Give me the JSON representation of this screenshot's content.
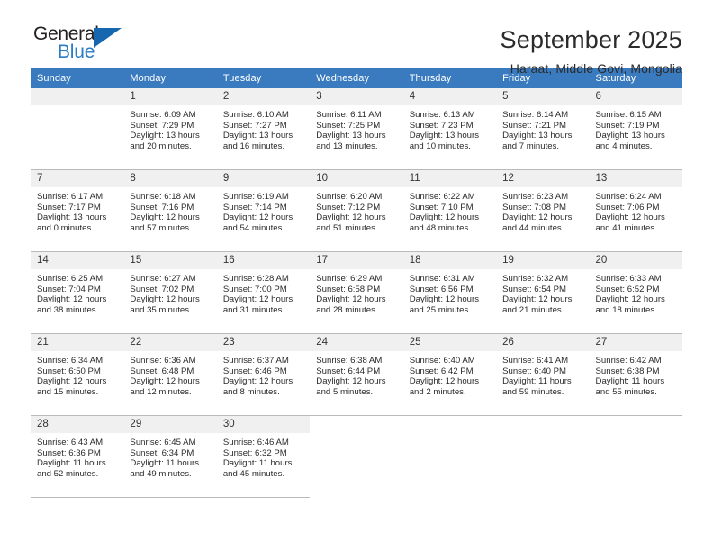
{
  "brand": {
    "name_top": "General",
    "name_bottom": "Blue",
    "triangle_color": "#1666b0",
    "blue": "#2b7cc4"
  },
  "header": {
    "month_title": "September 2025",
    "location": "Haraat, Middle Govi, Mongolia"
  },
  "calendar": {
    "header_bg": "#3a7bbf",
    "daynum_bg": "#f0f0f0",
    "weekdays": [
      "Sunday",
      "Monday",
      "Tuesday",
      "Wednesday",
      "Thursday",
      "Friday",
      "Saturday"
    ],
    "weeks": [
      [
        {
          "day": "",
          "sunrise": "",
          "sunset": "",
          "daylight1": "",
          "daylight2": "",
          "blank": true
        },
        {
          "day": "1",
          "sunrise": "Sunrise: 6:09 AM",
          "sunset": "Sunset: 7:29 PM",
          "daylight1": "Daylight: 13 hours",
          "daylight2": "and 20 minutes."
        },
        {
          "day": "2",
          "sunrise": "Sunrise: 6:10 AM",
          "sunset": "Sunset: 7:27 PM",
          "daylight1": "Daylight: 13 hours",
          "daylight2": "and 16 minutes."
        },
        {
          "day": "3",
          "sunrise": "Sunrise: 6:11 AM",
          "sunset": "Sunset: 7:25 PM",
          "daylight1": "Daylight: 13 hours",
          "daylight2": "and 13 minutes."
        },
        {
          "day": "4",
          "sunrise": "Sunrise: 6:13 AM",
          "sunset": "Sunset: 7:23 PM",
          "daylight1": "Daylight: 13 hours",
          "daylight2": "and 10 minutes."
        },
        {
          "day": "5",
          "sunrise": "Sunrise: 6:14 AM",
          "sunset": "Sunset: 7:21 PM",
          "daylight1": "Daylight: 13 hours",
          "daylight2": "and 7 minutes."
        },
        {
          "day": "6",
          "sunrise": "Sunrise: 6:15 AM",
          "sunset": "Sunset: 7:19 PM",
          "daylight1": "Daylight: 13 hours",
          "daylight2": "and 4 minutes."
        }
      ],
      [
        {
          "day": "7",
          "sunrise": "Sunrise: 6:17 AM",
          "sunset": "Sunset: 7:17 PM",
          "daylight1": "Daylight: 13 hours",
          "daylight2": "and 0 minutes."
        },
        {
          "day": "8",
          "sunrise": "Sunrise: 6:18 AM",
          "sunset": "Sunset: 7:16 PM",
          "daylight1": "Daylight: 12 hours",
          "daylight2": "and 57 minutes."
        },
        {
          "day": "9",
          "sunrise": "Sunrise: 6:19 AM",
          "sunset": "Sunset: 7:14 PM",
          "daylight1": "Daylight: 12 hours",
          "daylight2": "and 54 minutes."
        },
        {
          "day": "10",
          "sunrise": "Sunrise: 6:20 AM",
          "sunset": "Sunset: 7:12 PM",
          "daylight1": "Daylight: 12 hours",
          "daylight2": "and 51 minutes."
        },
        {
          "day": "11",
          "sunrise": "Sunrise: 6:22 AM",
          "sunset": "Sunset: 7:10 PM",
          "daylight1": "Daylight: 12 hours",
          "daylight2": "and 48 minutes."
        },
        {
          "day": "12",
          "sunrise": "Sunrise: 6:23 AM",
          "sunset": "Sunset: 7:08 PM",
          "daylight1": "Daylight: 12 hours",
          "daylight2": "and 44 minutes."
        },
        {
          "day": "13",
          "sunrise": "Sunrise: 6:24 AM",
          "sunset": "Sunset: 7:06 PM",
          "daylight1": "Daylight: 12 hours",
          "daylight2": "and 41 minutes."
        }
      ],
      [
        {
          "day": "14",
          "sunrise": "Sunrise: 6:25 AM",
          "sunset": "Sunset: 7:04 PM",
          "daylight1": "Daylight: 12 hours",
          "daylight2": "and 38 minutes."
        },
        {
          "day": "15",
          "sunrise": "Sunrise: 6:27 AM",
          "sunset": "Sunset: 7:02 PM",
          "daylight1": "Daylight: 12 hours",
          "daylight2": "and 35 minutes."
        },
        {
          "day": "16",
          "sunrise": "Sunrise: 6:28 AM",
          "sunset": "Sunset: 7:00 PM",
          "daylight1": "Daylight: 12 hours",
          "daylight2": "and 31 minutes."
        },
        {
          "day": "17",
          "sunrise": "Sunrise: 6:29 AM",
          "sunset": "Sunset: 6:58 PM",
          "daylight1": "Daylight: 12 hours",
          "daylight2": "and 28 minutes."
        },
        {
          "day": "18",
          "sunrise": "Sunrise: 6:31 AM",
          "sunset": "Sunset: 6:56 PM",
          "daylight1": "Daylight: 12 hours",
          "daylight2": "and 25 minutes."
        },
        {
          "day": "19",
          "sunrise": "Sunrise: 6:32 AM",
          "sunset": "Sunset: 6:54 PM",
          "daylight1": "Daylight: 12 hours",
          "daylight2": "and 21 minutes."
        },
        {
          "day": "20",
          "sunrise": "Sunrise: 6:33 AM",
          "sunset": "Sunset: 6:52 PM",
          "daylight1": "Daylight: 12 hours",
          "daylight2": "and 18 minutes."
        }
      ],
      [
        {
          "day": "21",
          "sunrise": "Sunrise: 6:34 AM",
          "sunset": "Sunset: 6:50 PM",
          "daylight1": "Daylight: 12 hours",
          "daylight2": "and 15 minutes."
        },
        {
          "day": "22",
          "sunrise": "Sunrise: 6:36 AM",
          "sunset": "Sunset: 6:48 PM",
          "daylight1": "Daylight: 12 hours",
          "daylight2": "and 12 minutes."
        },
        {
          "day": "23",
          "sunrise": "Sunrise: 6:37 AM",
          "sunset": "Sunset: 6:46 PM",
          "daylight1": "Daylight: 12 hours",
          "daylight2": "and 8 minutes."
        },
        {
          "day": "24",
          "sunrise": "Sunrise: 6:38 AM",
          "sunset": "Sunset: 6:44 PM",
          "daylight1": "Daylight: 12 hours",
          "daylight2": "and 5 minutes."
        },
        {
          "day": "25",
          "sunrise": "Sunrise: 6:40 AM",
          "sunset": "Sunset: 6:42 PM",
          "daylight1": "Daylight: 12 hours",
          "daylight2": "and 2 minutes."
        },
        {
          "day": "26",
          "sunrise": "Sunrise: 6:41 AM",
          "sunset": "Sunset: 6:40 PM",
          "daylight1": "Daylight: 11 hours",
          "daylight2": "and 59 minutes."
        },
        {
          "day": "27",
          "sunrise": "Sunrise: 6:42 AM",
          "sunset": "Sunset: 6:38 PM",
          "daylight1": "Daylight: 11 hours",
          "daylight2": "and 55 minutes."
        }
      ],
      [
        {
          "day": "28",
          "sunrise": "Sunrise: 6:43 AM",
          "sunset": "Sunset: 6:36 PM",
          "daylight1": "Daylight: 11 hours",
          "daylight2": "and 52 minutes."
        },
        {
          "day": "29",
          "sunrise": "Sunrise: 6:45 AM",
          "sunset": "Sunset: 6:34 PM",
          "daylight1": "Daylight: 11 hours",
          "daylight2": "and 49 minutes."
        },
        {
          "day": "30",
          "sunrise": "Sunrise: 6:46 AM",
          "sunset": "Sunset: 6:32 PM",
          "daylight1": "Daylight: 11 hours",
          "daylight2": "and 45 minutes."
        },
        {
          "day": "",
          "sunrise": "",
          "sunset": "",
          "daylight1": "",
          "daylight2": "",
          "blank": true,
          "nofill": true
        },
        {
          "day": "",
          "sunrise": "",
          "sunset": "",
          "daylight1": "",
          "daylight2": "",
          "blank": true,
          "nofill": true
        },
        {
          "day": "",
          "sunrise": "",
          "sunset": "",
          "daylight1": "",
          "daylight2": "",
          "blank": true,
          "nofill": true
        },
        {
          "day": "",
          "sunrise": "",
          "sunset": "",
          "daylight1": "",
          "daylight2": "",
          "blank": true,
          "nofill": true
        }
      ]
    ]
  }
}
